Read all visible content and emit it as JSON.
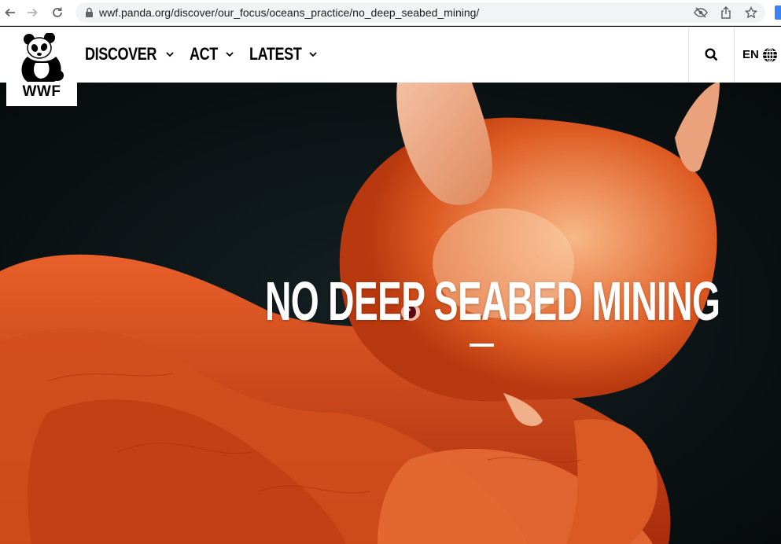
{
  "browser": {
    "url": "wwf.panda.org/discover/our_focus/oceans_practice/no_deep_seabed_mining/",
    "icons": [
      "back-arrow-icon",
      "forward-arrow-icon",
      "reload-icon",
      "lock-icon",
      "eye-slash-icon",
      "share-icon",
      "star-icon"
    ]
  },
  "header": {
    "logo_text": "WWF",
    "menu": [
      {
        "label": "DISCOVER"
      },
      {
        "label": "ACT"
      },
      {
        "label": "LATEST"
      }
    ],
    "language": "EN"
  },
  "hero": {
    "title": "NO DEEP SEABED MINING"
  },
  "colors": {
    "hero_background": "#0b1012",
    "octopus_orange": "#e0521e",
    "text_white": "#ffffff"
  }
}
